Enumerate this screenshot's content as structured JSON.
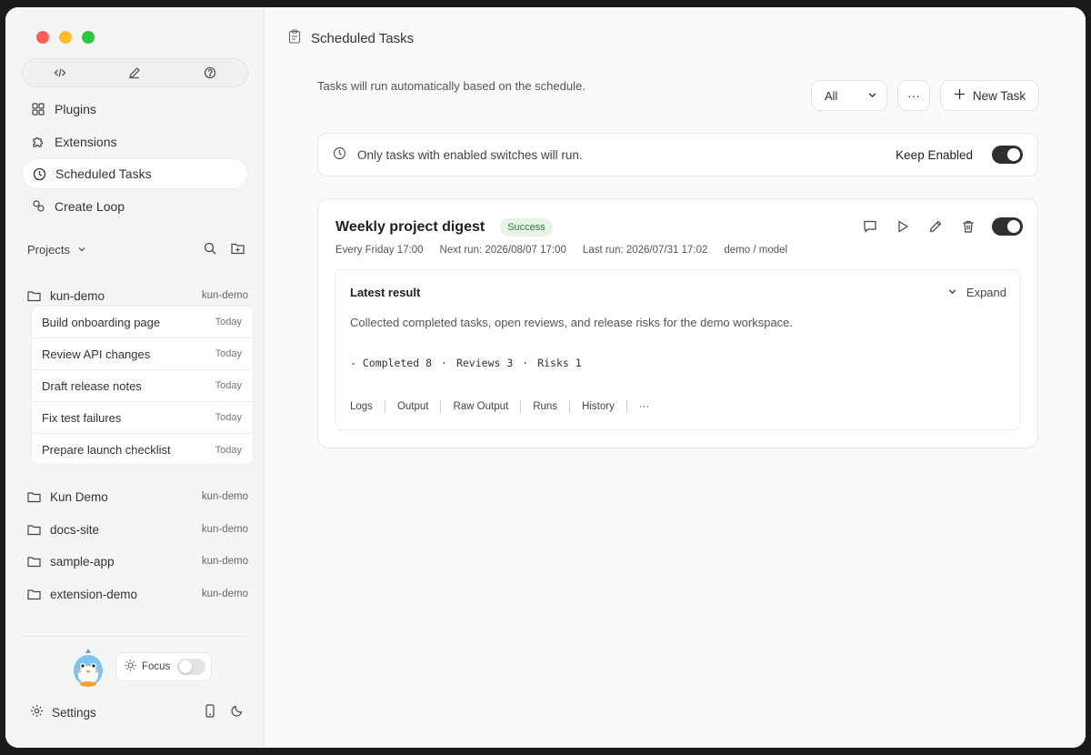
{
  "sidebar": {
    "nav": [
      {
        "label": "Plugins",
        "icon": "grid-icon"
      },
      {
        "label": "Extensions",
        "icon": "puzzle-icon"
      },
      {
        "label": "Scheduled Tasks",
        "icon": "clock-icon",
        "active": true
      },
      {
        "label": "Create Loop",
        "icon": "loop-icon"
      }
    ],
    "projects_label": "Projects",
    "projects": [
      {
        "name": "kun-demo",
        "tag": "kun-demo"
      },
      {
        "name": "Kun Demo",
        "tag": "kun-demo"
      },
      {
        "name": "docs-site",
        "tag": "kun-demo"
      },
      {
        "name": "sample-app",
        "tag": "kun-demo"
      },
      {
        "name": "extension-demo",
        "tag": "kun-demo"
      }
    ],
    "tasks": [
      {
        "label": "Build onboarding page",
        "when": "Today"
      },
      {
        "label": "Review API changes",
        "when": "Today"
      },
      {
        "label": "Draft release notes",
        "when": "Today"
      },
      {
        "label": "Fix test failures",
        "when": "Today"
      },
      {
        "label": "Prepare launch checklist",
        "when": "Today"
      }
    ],
    "focus_label": "Focus",
    "settings_label": "Settings"
  },
  "main": {
    "title": "Scheduled Tasks",
    "subtitle": "Tasks will run automatically based on the schedule.",
    "filter_value": "All",
    "more_label": "···",
    "new_task_label": "New Task",
    "notice_text": "Only tasks with enabled switches will run.",
    "keep_enabled_label": "Keep Enabled",
    "task": {
      "title": "Weekly project digest",
      "status": "Success",
      "schedule": "Every Friday 17:00",
      "next_run": "Next run: 2026/08/07 17:00",
      "last_run": "Last run: 2026/07/31 17:02",
      "model": "demo / model",
      "result_heading": "Latest result",
      "expand_label": "Expand",
      "result_text": "Collected completed tasks, open reviews, and release risks for the demo workspace.",
      "stats": [
        "- Completed 8",
        "·",
        "Reviews 3",
        "·",
        "Risks 1"
      ],
      "tabs": [
        "Logs",
        "Output",
        "Raw Output",
        "Runs",
        "History",
        "···"
      ]
    }
  },
  "colors": {
    "accent_toggle": "#2f2f2f",
    "success_text": "#2f7a3e",
    "success_bg": "#e6f4e8"
  }
}
